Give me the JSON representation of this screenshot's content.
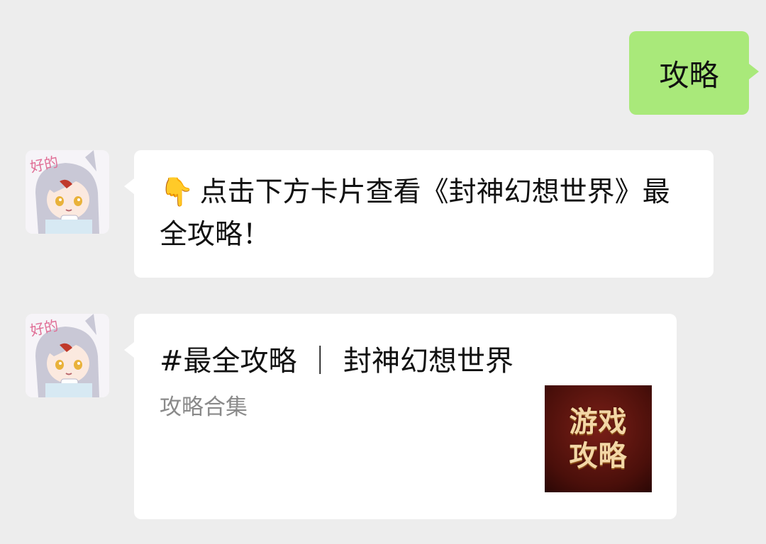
{
  "conversation": {
    "outgoing": {
      "text": "攻略",
      "bubble_color": "#a9e97a"
    },
    "incoming": [
      {
        "avatar_label": "好的",
        "hand_emoji": "👇",
        "text": "点击下方卡片查看《封神幻想世界》最全攻略！"
      },
      {
        "avatar_label": "好的",
        "card": {
          "title": "#最全攻略 ｜ 封神幻想世界",
          "subtitle": "攻略合集",
          "thumbnail": {
            "line1": "游戏",
            "line2": "攻略"
          }
        }
      }
    ]
  },
  "colors": {
    "background": "#ededed",
    "incoming_bubble": "#ffffff",
    "thumbnail_bg": "#5a140e",
    "thumbnail_text": "#f3d7a6"
  }
}
